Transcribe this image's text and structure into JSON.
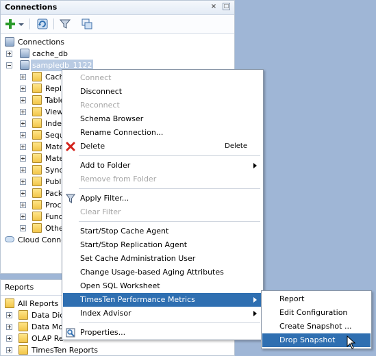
{
  "connections_panel": {
    "title": "Connections",
    "close_glyph": "×",
    "minimize_glyph": "□",
    "toolbar": [
      {
        "name": "new-connection-icon"
      },
      {
        "name": "dropdown-arrow-icon"
      },
      {
        "name": "refresh-icon"
      },
      {
        "name": "filter-icon"
      },
      {
        "name": "schema-browser-icon"
      }
    ],
    "tree": {
      "root": "Connections",
      "connections": [
        {
          "label": "cache_db"
        },
        {
          "label": "sampledb_1122"
        }
      ],
      "children": [
        "Cach",
        "Replic",
        "Table",
        "Views",
        "Index",
        "Sequ",
        "Mate",
        "Mate",
        "Syno",
        "Public",
        "Packa",
        "Proce",
        "Funct",
        "Othe"
      ],
      "cloud": "Cloud Connec"
    }
  },
  "reports_panel": {
    "title": "Reports",
    "items": [
      "All Reports",
      "Data Dicti",
      "Data Mod",
      "OLAP Re",
      "TimesTen Reports"
    ]
  },
  "context_menu": {
    "items": [
      {
        "label": "Connect",
        "disabled": true
      },
      {
        "label": "Disconnect",
        "underline": "i"
      },
      {
        "label": "Reconnect",
        "disabled": true
      },
      {
        "label": "Schema Browser",
        "underline": "S"
      },
      {
        "label": "Rename Connection..."
      },
      {
        "label": "Delete",
        "accel": "Delete",
        "icon": "delete-icon"
      },
      {
        "label": "Add to Folder",
        "submenu": true
      },
      {
        "label": "Remove from Folder",
        "disabled": true
      },
      {
        "label": "Apply Filter...",
        "icon": "filter-icon"
      },
      {
        "label": "Clear Filter",
        "disabled": true
      },
      {
        "label": "Start/Stop Cache Agent"
      },
      {
        "label": "Start/Stop Replication Agent"
      },
      {
        "label": "Set Cache Administration User"
      },
      {
        "label": "Change Usage-based Aging Attributes"
      },
      {
        "label": "Open SQL Worksheet"
      },
      {
        "label": "TimesTen Performance Metrics",
        "submenu": true,
        "highlighted": true
      },
      {
        "label": "Index Advisor",
        "submenu": true
      },
      {
        "label": "Properties...",
        "icon": "properties-icon"
      }
    ]
  },
  "submenu": {
    "items": [
      {
        "label": "Report"
      },
      {
        "label": "Edit Configuration"
      },
      {
        "label": "Create Snapshot ..."
      },
      {
        "label": "Drop Snapshot",
        "highlighted": true
      }
    ]
  }
}
